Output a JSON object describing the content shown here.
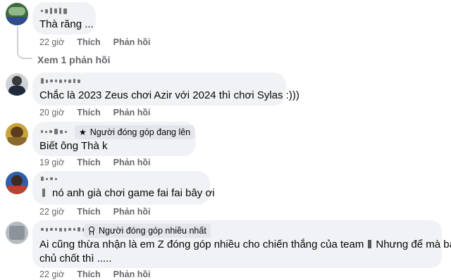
{
  "comments": [
    {
      "text": "Thà răng ...",
      "time": "22 giờ",
      "like": "Thích",
      "reply": "Phản hồi",
      "view_replies": "Xem 1 phản hồi"
    },
    {
      "text": "Chắc là 2023 Zeus chơi Azir với 2024 thì chơi Sylas :)))",
      "time": "20 giờ",
      "like": "Thích",
      "reply": "Phản hồi"
    },
    {
      "badge": "Người đóng góp đang lên",
      "badge_icon": "star-icon",
      "text": "Biết ông Thà k",
      "time": "19 giờ",
      "like": "Thích",
      "reply": "Phản hồi"
    },
    {
      "text": "nó anh già chơi game fai fai bây ơi",
      "time": "22 giờ",
      "like": "Thích",
      "reply": "Phản hồi"
    },
    {
      "badge": "Người đóng góp nhiều nhất",
      "badge_icon": "award-icon",
      "text_line1_a": "Ai cũng thừa nhận là em Z đóng góp nhiều cho chiến thắng của team",
      "text_line1_b": "Nhưng để mà bảo",
      "text_line2": "chủ chốt thì .....",
      "time": "22 giờ",
      "like": "Thích",
      "reply": "Phản hồi"
    }
  ]
}
